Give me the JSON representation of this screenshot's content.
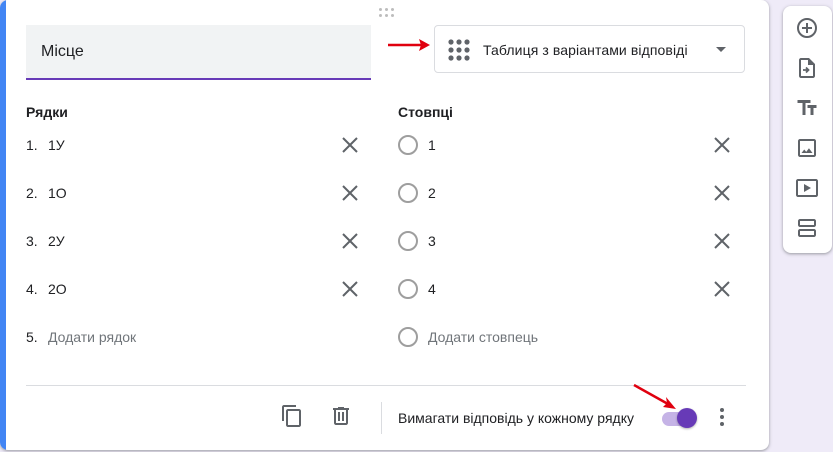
{
  "question": {
    "title": "Місце",
    "type_label": "Таблиця з варіантами відповіді",
    "type_icon": "grid-icon"
  },
  "rows": {
    "heading": "Рядки",
    "items": [
      {
        "num": "1.",
        "label": "1У"
      },
      {
        "num": "2.",
        "label": "1О"
      },
      {
        "num": "3.",
        "label": "2У"
      },
      {
        "num": "4.",
        "label": "2О"
      }
    ],
    "add": {
      "num": "5.",
      "label": "Додати рядок"
    }
  },
  "columns": {
    "heading": "Стовпці",
    "items": [
      {
        "label": "1"
      },
      {
        "label": "2"
      },
      {
        "label": "3"
      },
      {
        "label": "4"
      }
    ],
    "add": {
      "label": "Додати стовпець"
    }
  },
  "footer": {
    "required_label": "Вимагати відповідь у кожному рядку",
    "required_on": true
  },
  "toolbar": {
    "items": [
      "add-question-icon",
      "import-questions-icon",
      "title-text-icon",
      "image-icon",
      "video-icon",
      "section-icon"
    ]
  },
  "colors": {
    "accent": "#673ab7",
    "card_left_bar": "#4285f4",
    "annotation_arrow": "#e0000f"
  }
}
